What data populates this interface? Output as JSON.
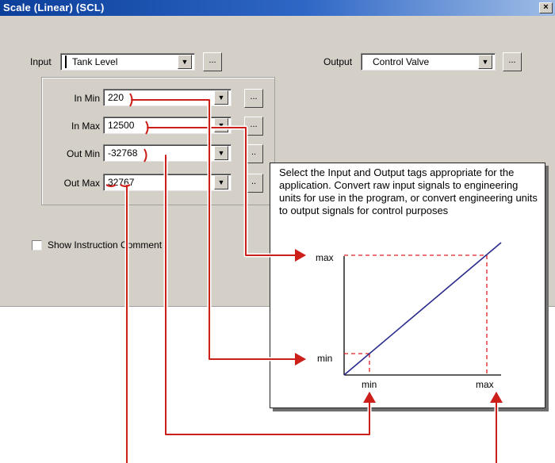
{
  "window": {
    "title": "Scale (Linear) (SCL)",
    "close_label": "×"
  },
  "input": {
    "label": "Input",
    "value": "Tank Level",
    "browse_label": "..."
  },
  "output": {
    "label": "Output",
    "value": "Control Valve",
    "browse_label": "..."
  },
  "params": [
    {
      "label": "In Min",
      "value": "220",
      "browse_label": "..."
    },
    {
      "label": "In Max",
      "value": "12500",
      "browse_label": "..."
    },
    {
      "label": "Out Min",
      "value": "-32768",
      "browse_label": ".."
    },
    {
      "label": "Out Max",
      "value": "32767",
      "browse_label": ".."
    }
  ],
  "show_comment": {
    "label": "Show Instruction Comment",
    "checked": false
  },
  "callout": {
    "text": "Select the Input and Output tags appropriate for the application. Convert raw input signals to engineering units for use in the program, or convert engineering units to output signals for control purposes",
    "y_max_label": "max",
    "y_min_label": "min",
    "x_min_label": "min",
    "x_max_label": "max"
  },
  "colors": {
    "arrow": "#cc1f1a",
    "scale_line": "#2a2a8c",
    "guide": "#e02020"
  },
  "icons": {
    "dropdown": "chevron-down-icon",
    "ellipsis": "ellipsis-icon",
    "close": "close-icon"
  }
}
